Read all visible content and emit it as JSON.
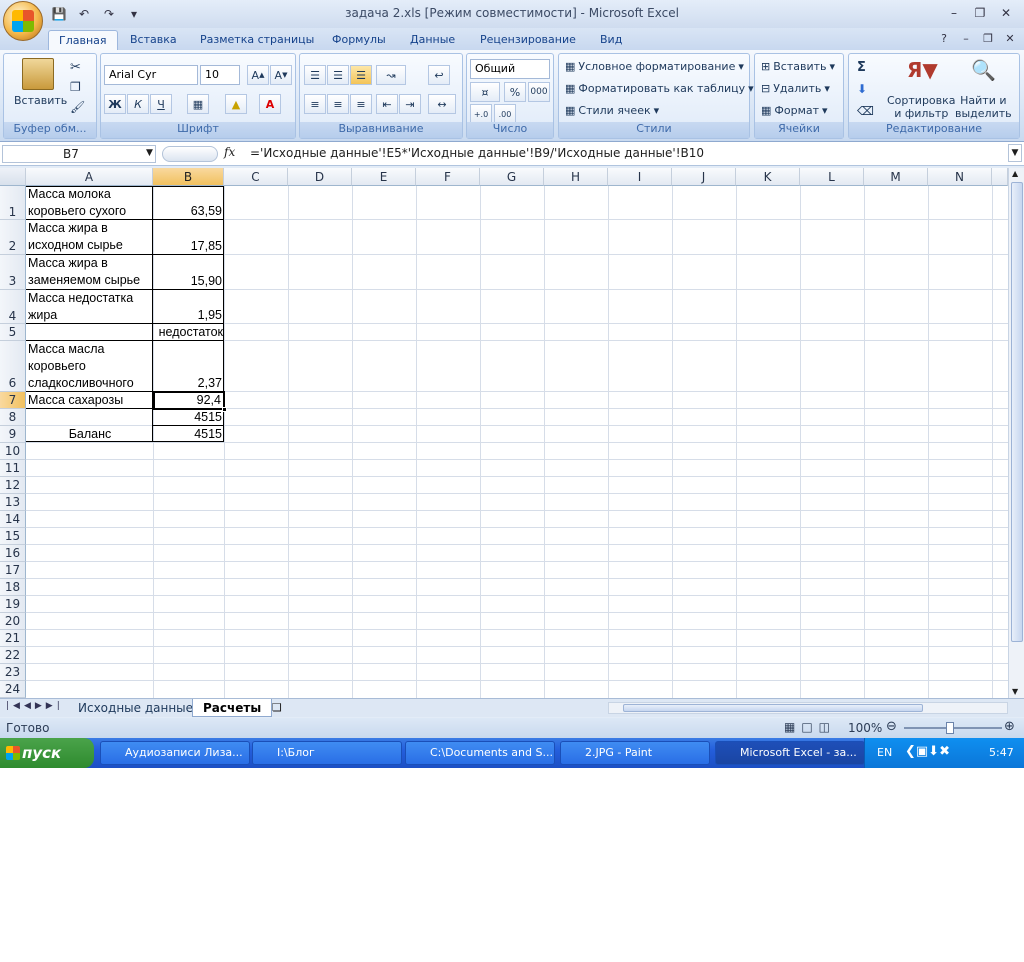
{
  "window": {
    "title": "задача 2.xls  [Режим совместимости] - Microsoft Excel"
  },
  "ribbon_tabs": [
    "Главная",
    "Вставка",
    "Разметка страницы",
    "Формулы",
    "Данные",
    "Рецензирование",
    "Вид"
  ],
  "clipboard": {
    "paste": "Вставить",
    "label": "Буфер обм..."
  },
  "font": {
    "name": "Arial Cyr",
    "size": "10",
    "bold": "Ж",
    "italic": "К",
    "underline": "Ч",
    "label": "Шрифт"
  },
  "alignment": {
    "label": "Выравнивание"
  },
  "number": {
    "format": "Общий",
    "percent": "%",
    "thousands": "000",
    "label": "Число"
  },
  "styles": {
    "conditional": "Условное форматирование",
    "as_table": "Форматировать как таблицу",
    "cell_styles": "Стили ячеек",
    "label": "Стили"
  },
  "cells": {
    "insert": "Вставить",
    "delete": "Удалить",
    "format": "Формат",
    "label": "Ячейки"
  },
  "editing": {
    "sigma": "Σ",
    "sort": "Сортировка\nи фильтр",
    "find": "Найти и\nвыделить",
    "label": "Редактирование"
  },
  "formula_bar": {
    "name_box": "B7",
    "fx": "fx",
    "formula": "='Исходные данные'!E5*'Исходные данные'!B9/'Исходные данные'!B10"
  },
  "columns": [
    "A",
    "B",
    "C",
    "D",
    "E",
    "F",
    "G",
    "H",
    "I",
    "J",
    "K",
    "L",
    "M",
    "N"
  ],
  "rows": [
    "1",
    "2",
    "3",
    "4",
    "5",
    "6",
    "7",
    "8",
    "9",
    "10",
    "11",
    "12",
    "13",
    "14",
    "15",
    "16",
    "17",
    "18",
    "19",
    "20",
    "21",
    "22",
    "23",
    "24"
  ],
  "cells_data": {
    "a1": "Масса молока\nкоровьего сухого",
    "b1": "63,59",
    "a2": "Масса жира в\nисходном сырье",
    "b2": "17,85",
    "a3": "Масса жира в\nзаменяемом сырье",
    "b3": "15,90",
    "a4": "Масса недостатка\nжира",
    "b4": "1,95",
    "b5": "недостаток",
    "a6": "Масса масла\nкоровьего\nсладкосливочного",
    "b6": "2,37",
    "a7": "Масса сахарозы",
    "b7": "92,4",
    "b8": "4515",
    "a9": "Баланс",
    "b9": "4515"
  },
  "sheet_tabs": [
    "Исходные данные",
    "Расчеты"
  ],
  "status": {
    "ready": "Готово",
    "zoom": "100%"
  },
  "taskbar": {
    "start": "пуск",
    "items": [
      "Аудиозаписи Лиза...",
      "I:\\Блог",
      "C:\\Documents and S...",
      "2.JPG - Paint",
      "Microsoft Excel - за..."
    ],
    "lang": "EN",
    "clock": "5:47"
  }
}
